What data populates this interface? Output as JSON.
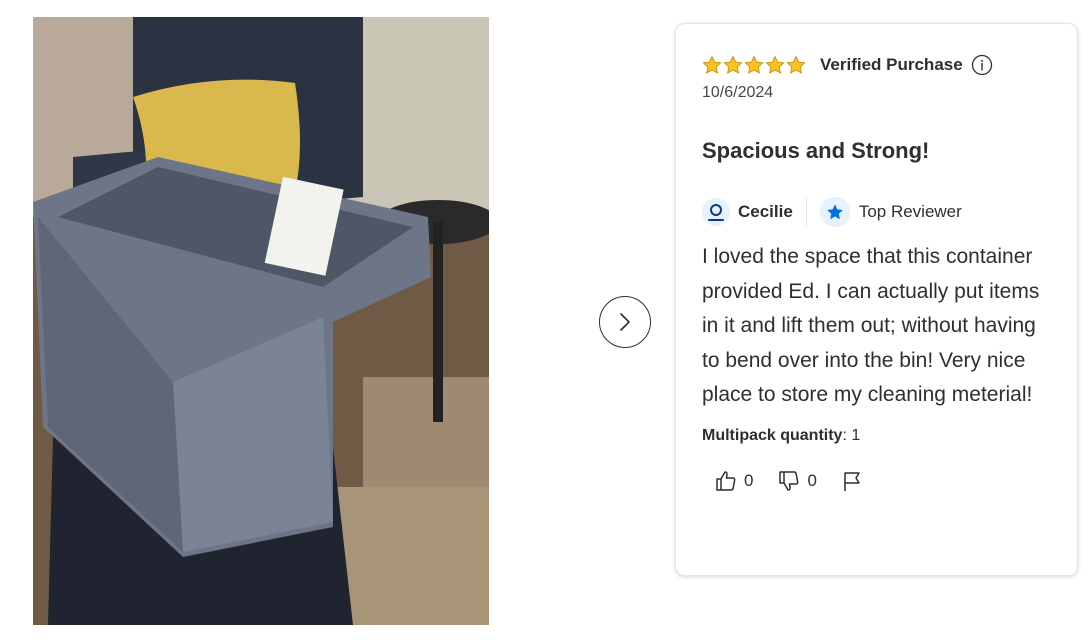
{
  "review": {
    "rating": 5,
    "max_rating": 5,
    "verified_label": "Verified Purchase",
    "date": "10/6/2024",
    "title": "Spacious and Strong!",
    "reviewer_name": "Cecilie",
    "reviewer_badge": "Top Reviewer",
    "body": "I loved the space that this container provided Ed. I can actually put items in it and lift them out; without having to bend over into the bin! Very nice place to store my cleaning meterial!",
    "multipack_label": "Multipack quantity",
    "multipack_value": ": 1",
    "helpful_count": "0",
    "unhelpful_count": "0"
  },
  "icons": {
    "star": "star-icon",
    "info": "info-icon",
    "reviewer": "user-icon",
    "badge": "star-badge-icon",
    "thumbs_up": "thumbs-up-icon",
    "thumbs_down": "thumbs-down-icon",
    "flag": "flag-icon",
    "next": "chevron-right-icon"
  },
  "colors": {
    "star": "#ffc220",
    "brand_blue": "#0071dc",
    "text": "#2e2f32"
  }
}
